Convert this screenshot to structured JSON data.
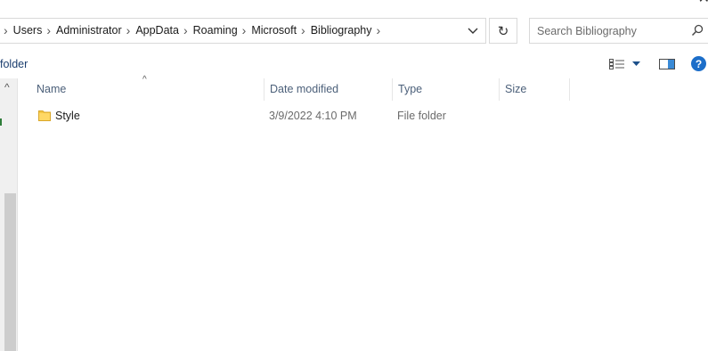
{
  "window": {
    "close_glyph": "✕"
  },
  "address": {
    "path": [
      "Users",
      "Administrator",
      "AppData",
      "Roaming",
      "Microsoft",
      "Bibliography"
    ],
    "separator": "›"
  },
  "refresh_glyph": "↻",
  "search": {
    "placeholder": "Search Bibliography"
  },
  "toolbar": {
    "label": "folder",
    "help_glyph": "?"
  },
  "nav": {
    "scroll_up_glyph": "^"
  },
  "list": {
    "sort_glyph": "^",
    "columns": {
      "name": "Name",
      "date_modified": "Date modified",
      "type": "Type",
      "size": "Size"
    },
    "rows": [
      {
        "name": "Style",
        "date_modified": "3/9/2022 4:10 PM",
        "type": "File folder",
        "size": ""
      }
    ]
  },
  "colors": {
    "accent": "#1c6ec9",
    "folder": "#f5c744",
    "header_text": "#4c607a"
  }
}
